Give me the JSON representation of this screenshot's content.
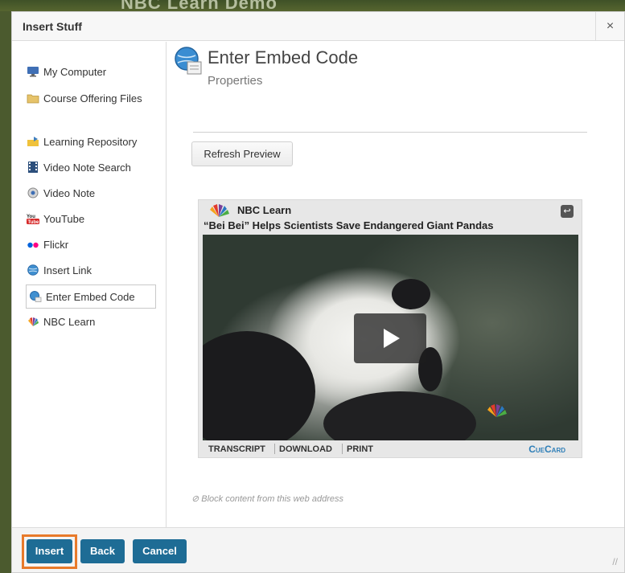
{
  "background": {
    "text": "NBC Learn Demo"
  },
  "dialog": {
    "title": "Insert Stuff",
    "close_label": "×"
  },
  "sidebar": {
    "items": [
      {
        "label": "My Computer",
        "icon": "monitor-icon"
      },
      {
        "label": "Course Offering Files",
        "icon": "folder-icon"
      },
      {
        "label": "Learning Repository",
        "icon": "repository-icon"
      },
      {
        "label": "Video Note Search",
        "icon": "film-icon"
      },
      {
        "label": "Video Note",
        "icon": "webcam-icon"
      },
      {
        "label": "YouTube",
        "icon": "youtube-icon"
      },
      {
        "label": "Flickr",
        "icon": "flickr-icon"
      },
      {
        "label": "Insert Link",
        "icon": "link-globe-icon"
      },
      {
        "label": "Enter Embed Code",
        "icon": "embed-globe-icon",
        "active": true
      },
      {
        "label": "NBC Learn",
        "icon": "nbc-peacock-icon"
      }
    ]
  },
  "main": {
    "heading": "Enter Embed Code",
    "subheading": "Properties",
    "refresh_label": "Refresh Preview",
    "player": {
      "brand": "NBC Learn",
      "video_title": "“Bei Bei” Helps Scientists Save Endangered Giant Pandas",
      "controls": [
        "TRANSCRIPT",
        "DOWNLOAD",
        "PRINT"
      ],
      "cuecard": "CueCard"
    },
    "block_link": "Block content from this web address",
    "block_icon": "⊘"
  },
  "footer": {
    "insert_label": "Insert",
    "back_label": "Back",
    "cancel_label": "Cancel"
  },
  "colors": {
    "primary_button": "#1e6c95",
    "focus_outline": "#e87a2b",
    "header_bg": "#4b5a2e"
  }
}
